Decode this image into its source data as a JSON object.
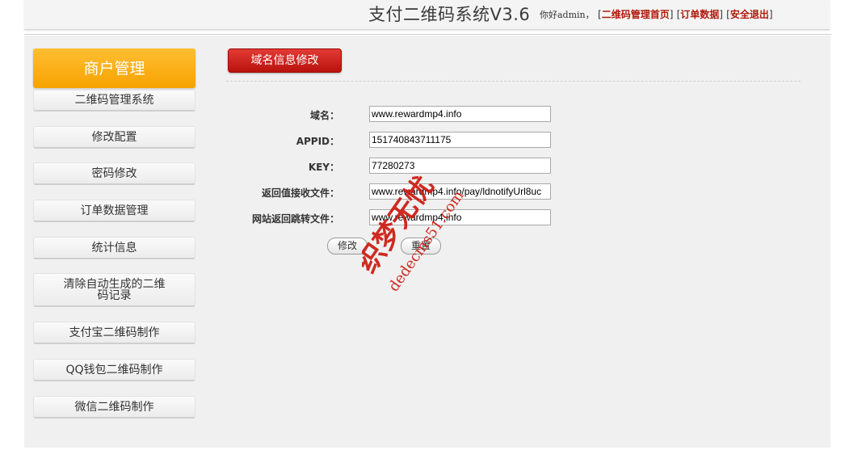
{
  "header": {
    "app_title": "支付二维码系统V3.6",
    "greeting": "你好admin，",
    "links": [
      {
        "label": "二维码管理首页"
      },
      {
        "label": "订单数据"
      },
      {
        "label": "安全退出"
      }
    ]
  },
  "sidebar": {
    "title": "商户管理",
    "items": [
      {
        "label": "二维码管理系统"
      },
      {
        "label": "修改配置"
      },
      {
        "label": "密码修改"
      },
      {
        "label": "订单数据管理"
      },
      {
        "label": "统计信息"
      },
      {
        "label": "清除自动生成的二维码记录"
      },
      {
        "label": "支付宝二维码制作"
      },
      {
        "label": "QQ钱包二维码制作"
      },
      {
        "label": "微信二维码制作"
      }
    ]
  },
  "content": {
    "tab_label": "域名信息修改",
    "fields": [
      {
        "label": "域名：",
        "value": "www.rewardmp4.info"
      },
      {
        "label": "APPID：",
        "value": "151740843711175"
      },
      {
        "label": "KEY：",
        "value": "77280273"
      },
      {
        "label": "返回值接收文件：",
        "value": "www.rewardmp4.info/pay/ldnotifyUrl8uc"
      },
      {
        "label": "网站返回跳转文件：",
        "value": "www.rewardmp4.info"
      }
    ],
    "submit_label": "修改",
    "reset_label": "重置"
  },
  "watermark": {
    "line1": "织梦无忧",
    "line2": "dedecms51.com"
  },
  "colors": {
    "accent_orange": "#f7a300",
    "accent_red": "#c4150f",
    "link_red": "#b11a0c",
    "panel_bg": "#f0f0f0"
  }
}
